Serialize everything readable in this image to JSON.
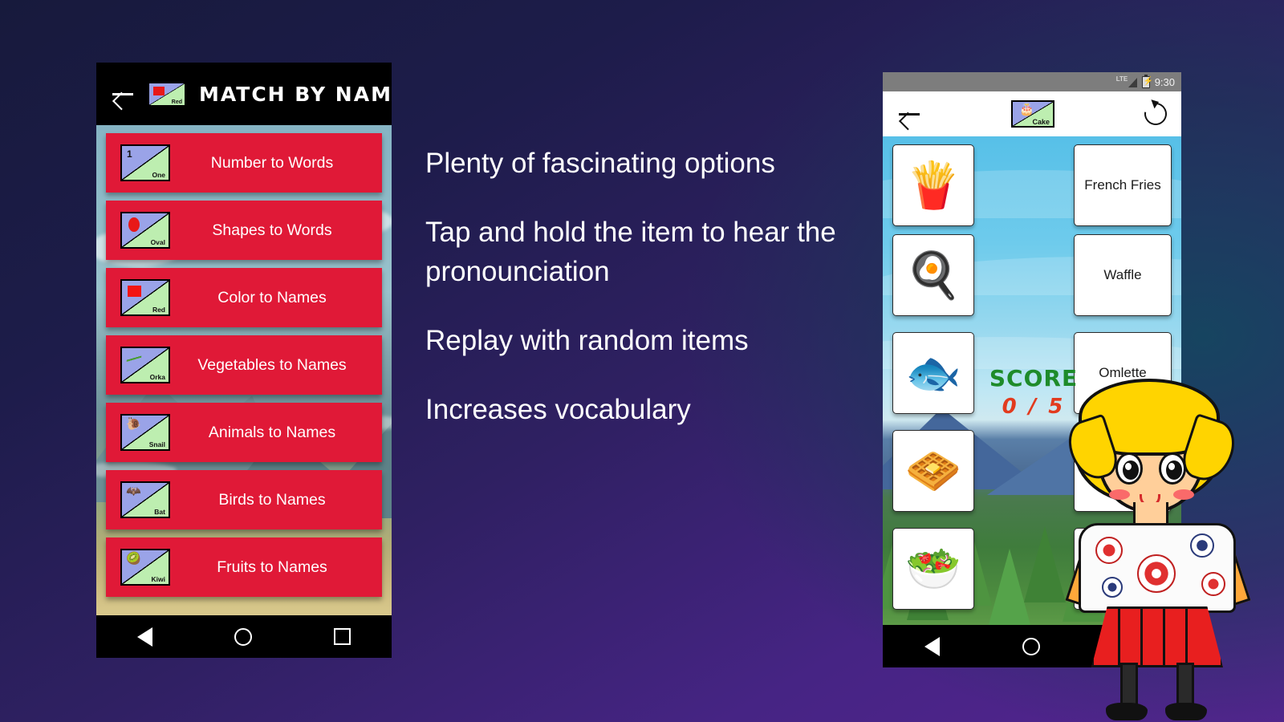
{
  "background": {
    "gradient_from": "#171a3c",
    "gradient_to": "#54248f",
    "accent_teal": "#16465f"
  },
  "left_phone": {
    "topbar": {
      "back_icon": "back-arrow-icon",
      "logo": {
        "symbol": "red-square",
        "label": "Red"
      },
      "title": "MATCH  BY  NAMES"
    },
    "menu_items": [
      {
        "tile_symbol": "1",
        "tile_label": "One",
        "label": "Number to Words",
        "icon": "number-one-tile-icon"
      },
      {
        "tile_symbol": "",
        "tile_label": "Oval",
        "label": "Shapes to Words",
        "icon": "oval-shape-tile-icon"
      },
      {
        "tile_symbol": "",
        "tile_label": "Red",
        "label": "Color to Names",
        "icon": "red-square-tile-icon"
      },
      {
        "tile_symbol": "",
        "tile_label": "Orka",
        "label": "Vegetables to Names",
        "icon": "okra-tile-icon"
      },
      {
        "tile_symbol": "🐌",
        "tile_label": "Snail",
        "label": "Animals to Names",
        "icon": "snail-tile-icon"
      },
      {
        "tile_symbol": "🦇",
        "tile_label": "Bat",
        "label": "Birds to Names",
        "icon": "bat-tile-icon"
      },
      {
        "tile_symbol": "🥝",
        "tile_label": "Kiwi",
        "label": "Fruits to Names",
        "icon": "kiwi-tile-icon"
      }
    ],
    "navbar": {
      "back": "nav-back-icon",
      "home": "nav-home-icon",
      "recents": "nav-recents-icon"
    },
    "accent_color": "#e01937"
  },
  "features": [
    "Plenty of fascinating options",
    "Tap and hold the item to hear the pronounciation",
    "Replay with random items",
    "Increases vocabulary"
  ],
  "right_phone": {
    "status_bar": {
      "network": "LTE",
      "battery": "charging",
      "time": "9:30"
    },
    "header": {
      "back_icon": "back-arrow-icon",
      "logo": {
        "symbol": "cake",
        "label": "Cake"
      },
      "refresh_icon": "refresh-icon"
    },
    "picture_cards": [
      {
        "name": "french-fries",
        "glyph": "🍟"
      },
      {
        "name": "fried-egg",
        "glyph": "🍳"
      },
      {
        "name": "fish-plate",
        "glyph": "🐟"
      },
      {
        "name": "waffle",
        "glyph": "🧇"
      },
      {
        "name": "salad-bowl",
        "glyph": "🥗"
      }
    ],
    "word_cards": [
      "French Fries",
      "Waffle",
      "Omlette",
      "",
      ""
    ],
    "score": {
      "label": "SCORE",
      "value": "0 / 5"
    },
    "navbar": {
      "back": "nav-back-icon",
      "home": "nav-home-icon",
      "recents": "nav-recents-icon"
    }
  },
  "mascot": {
    "name": "girl-character",
    "hair_color": "#ffd400",
    "skirt_color": "#e81f1f"
  }
}
